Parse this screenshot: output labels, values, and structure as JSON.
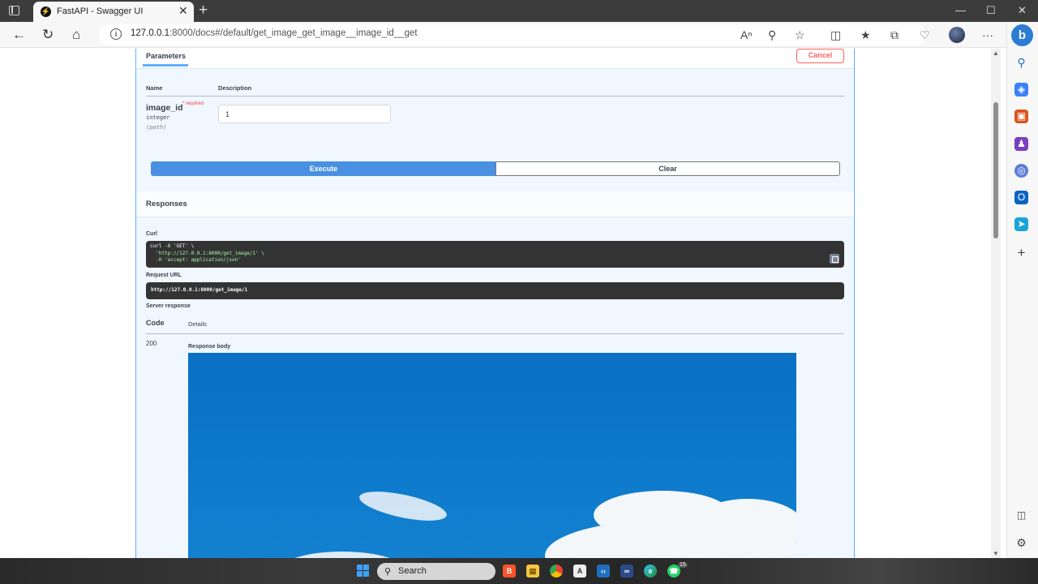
{
  "browser": {
    "tab_title": "FastAPI - Swagger UI",
    "tab_favicon": "⚡",
    "tab_close": "✕",
    "new_tab": "+",
    "url_host": "127.0.0.1",
    "url_path": ":8000/docs#/default/get_image_get_image__image_id__get",
    "min": "—",
    "max": "☐",
    "close": "✕"
  },
  "params": {
    "tab_label": "Parameters",
    "cancel_label": "Cancel",
    "col_name": "Name",
    "col_description": "Description",
    "param_name": "image_id",
    "required": "* required",
    "type": "integer",
    "location": "(path)",
    "value": "1"
  },
  "actions": {
    "execute": "Execute",
    "clear": "Clear"
  },
  "responses": {
    "title": "Responses",
    "curl_label": "Curl",
    "curl_line1": "curl -X 'GET' \\",
    "curl_line2": "  'http://127.0.0.1:8000/get_image/1' \\",
    "curl_line3": "  -H 'accept: application/json'",
    "request_url_label": "Request URL",
    "request_url": "http://127.0.0.1:8000/get_image/1",
    "server_response_label": "Server response",
    "code_col": "Code",
    "details_col": "Details",
    "code": "200",
    "response_body_label": "Response body"
  },
  "taskbar": {
    "search": "Search",
    "notification_count": "15"
  },
  "colors": {
    "get_blue": "#61affe",
    "execute_blue": "#4990e2",
    "cancel_red": "#ff6060"
  }
}
